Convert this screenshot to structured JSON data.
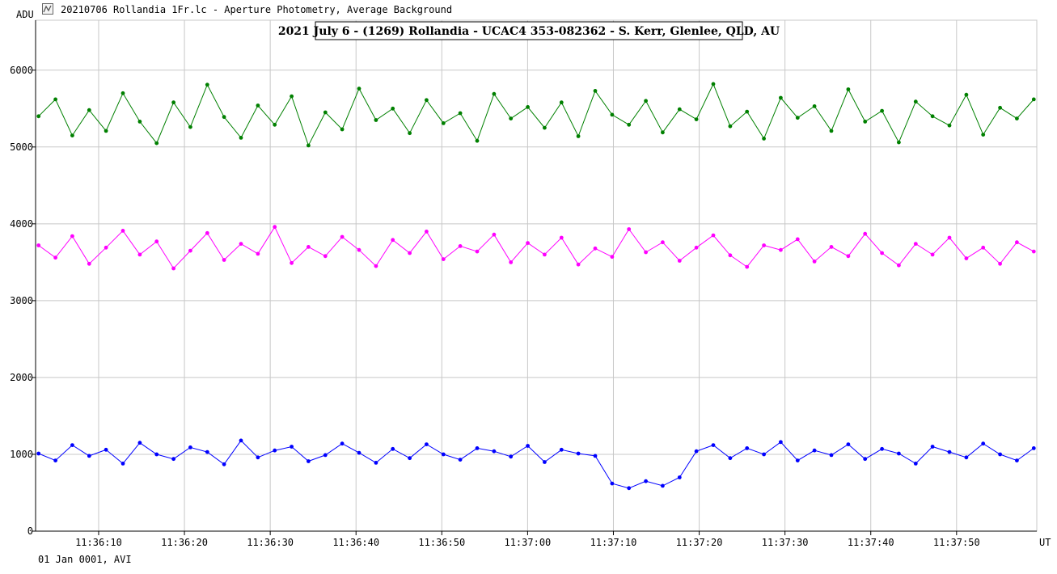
{
  "window": {
    "title": "20210706 Rollandia 1Fr.lc - Aperture Photometry, Average Background",
    "icon": "chart-app-icon"
  },
  "footer": {
    "text": "01 Jan 0001, AVI"
  },
  "colors": {
    "background": "#ffffff",
    "grid": "#c8c8c8",
    "axis": "#000000"
  },
  "chart_data": {
    "type": "scatter",
    "title": "2021 July 6 - (1269) Rollandia - UCAC4 353-082362 - S. Kerr, Glenlee, QLD, AU",
    "ylabel": "ADU",
    "xlabel": "UT",
    "grid": true,
    "ylim": [
      0,
      6000
    ],
    "y_ticks": [
      {
        "value": 0,
        "label": "0"
      },
      {
        "value": 1000,
        "label": "1000"
      },
      {
        "value": 2000,
        "label": "2000"
      },
      {
        "value": 3000,
        "label": "3000"
      },
      {
        "value": 4000,
        "label": "4000"
      },
      {
        "value": 5000,
        "label": "5000"
      },
      {
        "value": 6000,
        "label": "6000"
      }
    ],
    "x_range_seconds_after": [
      "11:36:03",
      "11:37:59"
    ],
    "x_ticks": [
      {
        "time": "11:36:10",
        "label": "11:36:10"
      },
      {
        "time": "11:36:20",
        "label": "11:36:20"
      },
      {
        "time": "11:36:30",
        "label": "11:36:30"
      },
      {
        "time": "11:36:40",
        "label": "11:36:40"
      },
      {
        "time": "11:36:50",
        "label": "11:36:50"
      },
      {
        "time": "11:37:00",
        "label": "11:37:00"
      },
      {
        "time": "11:37:10",
        "label": "11:37:10"
      },
      {
        "time": "11:37:20",
        "label": "11:37:20"
      },
      {
        "time": "11:37:30",
        "label": "11:37:30"
      },
      {
        "time": "11:37:40",
        "label": "11:37:40"
      },
      {
        "time": "11:37:50",
        "label": "11:37:50"
      }
    ],
    "x_axis_end_label": "UT",
    "series": [
      {
        "color": "#008000",
        "values": [
          5400,
          5620,
          5150,
          5480,
          5210,
          5700,
          5330,
          5050,
          5580,
          5260,
          5810,
          5390,
          5120,
          5540,
          5290,
          5660,
          5020,
          5450,
          5230,
          5760,
          5350,
          5500,
          5180,
          5610,
          5310,
          5440,
          5080,
          5690,
          5370,
          5520,
          5250,
          5580,
          5140,
          5730,
          5420,
          5290,
          5600,
          5190,
          5490,
          5360,
          5820,
          5270,
          5460,
          5110,
          5640,
          5380,
          5530,
          5210,
          5750,
          5330,
          5470,
          5060,
          5590,
          5400,
          5280,
          5680,
          5160,
          5510,
          5370,
          5620
        ]
      },
      {
        "color": "#ff00ff",
        "values": [
          3720,
          3560,
          3840,
          3480,
          3690,
          3910,
          3600,
          3770,
          3420,
          3650,
          3880,
          3530,
          3740,
          3610,
          3960,
          3490,
          3700,
          3580,
          3830,
          3660,
          3450,
          3790,
          3620,
          3900,
          3540,
          3710,
          3640,
          3860,
          3500,
          3750,
          3600,
          3820,
          3470,
          3680,
          3570,
          3930,
          3630,
          3760,
          3520,
          3690,
          3850,
          3590,
          3440,
          3720,
          3660,
          3800,
          3510,
          3700,
          3580,
          3870,
          3620,
          3460,
          3740,
          3600,
          3820,
          3550,
          3690,
          3480,
          3760,
          3640
        ]
      },
      {
        "color": "#0000ff",
        "values": [
          1010,
          920,
          1120,
          980,
          1060,
          880,
          1150,
          1000,
          940,
          1090,
          1030,
          870,
          1180,
          960,
          1050,
          1100,
          910,
          990,
          1140,
          1020,
          890,
          1070,
          950,
          1130,
          1000,
          930,
          1080,
          1040,
          970,
          1110,
          900,
          1060,
          1010,
          980,
          620,
          560,
          650,
          590,
          700,
          1040,
          1120,
          950,
          1080,
          1000,
          1160,
          920,
          1050,
          990,
          1130,
          940,
          1070,
          1010,
          880,
          1100,
          1030,
          960,
          1140,
          1000,
          920,
          1080
        ]
      }
    ]
  }
}
